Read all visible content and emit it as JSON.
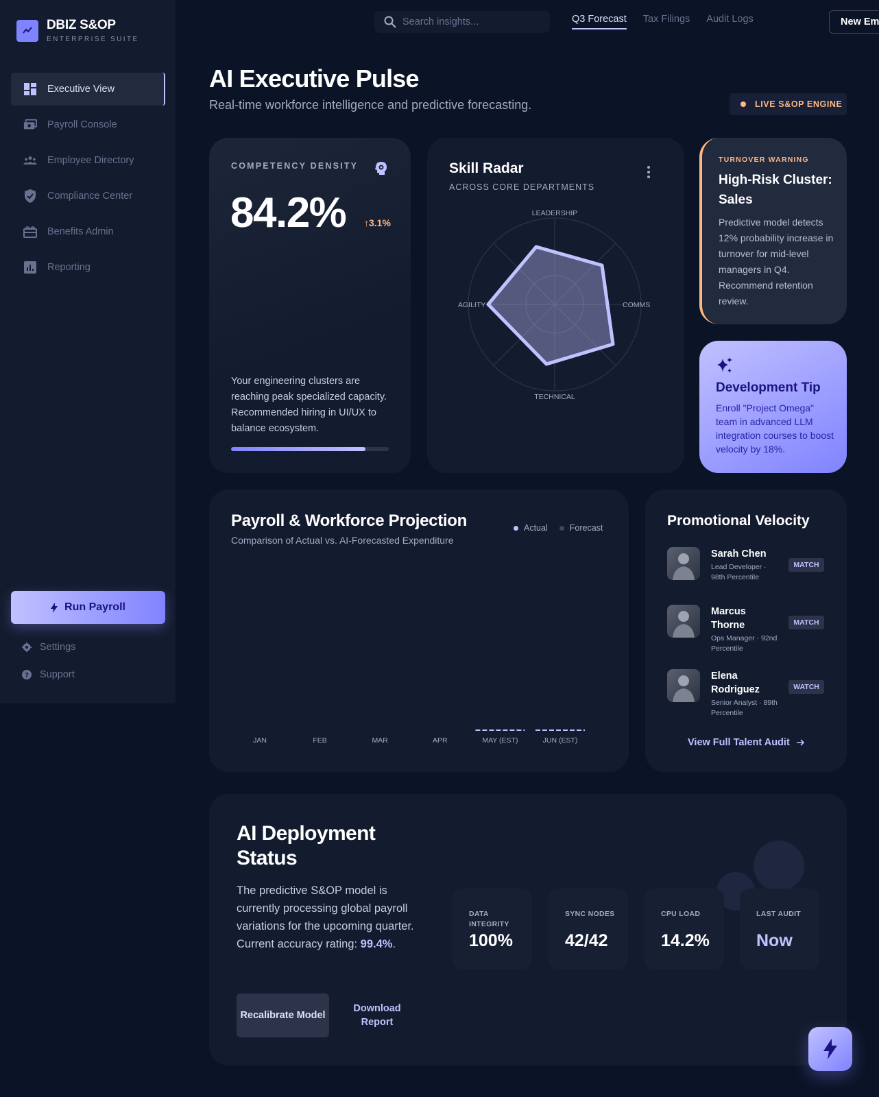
{
  "brand": {
    "name": "DBIZ S&OP",
    "subtitle": "ENTERPRISE SUITE",
    "logo_icon": "bar-chart-icon"
  },
  "sidebar": {
    "items": [
      {
        "label": "Executive View",
        "icon": "dashboard-icon",
        "active": true
      },
      {
        "label": "Payroll Console",
        "icon": "payments-icon",
        "active": false
      },
      {
        "label": "Employee Directory",
        "icon": "groups-icon",
        "active": false
      },
      {
        "label": "Compliance Center",
        "icon": "shield-icon",
        "active": false
      },
      {
        "label": "Benefits Admin",
        "icon": "gift-icon",
        "active": false
      },
      {
        "label": "Reporting",
        "icon": "analytics-icon",
        "active": false
      }
    ],
    "run_payroll_label": "Run Payroll",
    "footer": [
      {
        "label": "Settings",
        "icon": "gear-icon"
      },
      {
        "label": "Support",
        "icon": "help-icon"
      }
    ]
  },
  "topbar": {
    "search_placeholder": "Search insights...",
    "tabs": [
      {
        "label": "Q3 Forecast",
        "active": true
      },
      {
        "label": "Tax Filings",
        "active": false
      },
      {
        "label": "Audit Logs",
        "active": false
      }
    ],
    "new_button_label": "New Em"
  },
  "header": {
    "title": "AI Executive Pulse",
    "subtitle": "Real-time workforce intelligence and predictive forecasting.",
    "badge": "LIVE S&OP ENGINE"
  },
  "competency": {
    "label": "COMPETENCY DENSITY",
    "value": "84.2%",
    "delta": "3.1%",
    "text": "Your engineering clusters are reaching peak specialized capacity. Recommended hiring in UI/UX to balance ecosystem.",
    "progress": 0.85
  },
  "radar": {
    "title": "Skill Radar",
    "subtitle": "ACROSS CORE DEPARTMENTS",
    "axes": [
      "LEADERSHIP",
      "COMMS",
      "TECHNICAL",
      "AGILITY"
    ]
  },
  "turnover": {
    "label": "TURNOVER WARNING",
    "title": "High-Risk Cluster: Sales",
    "text": "Predictive model detects 12% probability increase in turnover for mid-level managers in Q4. Recommend retention review."
  },
  "tip": {
    "title": "Development Tip",
    "text": "Enroll \"Project Omega\" team in advanced LLM integration courses to boost velocity by 18%."
  },
  "payroll": {
    "title": "Payroll & Workforce Projection",
    "subtitle": "Comparison of Actual vs. AI-Forecasted Expenditure",
    "legend": [
      "Actual",
      "Forecast"
    ]
  },
  "chart_data": {
    "type": "bar",
    "categories": [
      "JAN",
      "FEB",
      "MAR",
      "APR",
      "MAY (EST)",
      "JUN (EST)"
    ],
    "series": [
      {
        "name": "Actual",
        "values": [
          0,
          0,
          0,
          0,
          null,
          null
        ]
      },
      {
        "name": "Forecast",
        "values": [
          null,
          null,
          null,
          null,
          0,
          0
        ]
      }
    ],
    "colors": {
      "actual": "#c0c1ff",
      "forecast": "#464554"
    }
  },
  "promo": {
    "title": "Promotional Velocity",
    "people": [
      {
        "name": "Sarah Chen",
        "role": "Lead Developer · 98th Percentile",
        "badge": "MATCH"
      },
      {
        "name": "Marcus Thorne",
        "role": "Ops Manager · 92nd Percentile",
        "badge": "MATCH"
      },
      {
        "name": "Elena Rodriguez",
        "role": "Senior Analyst · 89th Percentile",
        "badge": "WATCH"
      }
    ],
    "link": "View Full Talent Audit"
  },
  "deploy": {
    "title": "AI Deployment Status",
    "text": "The predictive S&OP model is currently processing global payroll variations for the upcoming quarter. Current accuracy rating:",
    "accuracy": "99.4%",
    "text_end": ".",
    "recalibrate": "Recalibrate Model",
    "download": "Download Report",
    "stats": [
      {
        "label": "DATA INTEGRITY",
        "value": "100%"
      },
      {
        "label": "SYNC NODES",
        "value": "42/42"
      },
      {
        "label": "CPU LOAD",
        "value": "14.2%"
      },
      {
        "label": "LAST AUDIT",
        "value": "Now"
      }
    ]
  },
  "colors": {
    "background": "#0b1326",
    "surface": "#131b2e",
    "primary": "#c0c1ff",
    "primary_strong": "#8083ff",
    "warning": "#ffb783"
  }
}
